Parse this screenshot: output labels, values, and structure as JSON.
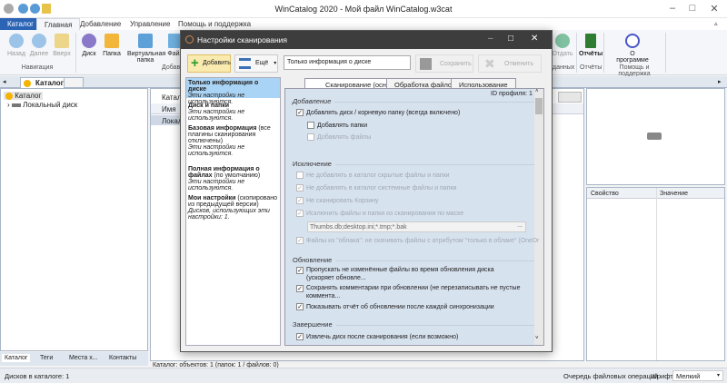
{
  "window": {
    "title": "WinCatalog 2020 - Мой файл WinCatalog.w3cat"
  },
  "ribbon_tabs": [
    "Каталог",
    "Главная",
    "Добавление",
    "Управление",
    "Помощь и поддержка"
  ],
  "ribbon": {
    "nav": [
      {
        "label": "Назад"
      },
      {
        "label": "Далее"
      },
      {
        "label": "Вверх"
      }
    ],
    "nav_group": "Навигация",
    "add": [
      {
        "label": "Диск"
      },
      {
        "label": "Папка"
      },
      {
        "label": "Виртуальная папка"
      },
      {
        "label": "Файл"
      }
    ],
    "add_group": "Добав",
    "give": "Отдать",
    "data_group": "данных",
    "reports": "Отчёты",
    "reports_group": "Отчёты",
    "about": "О программе",
    "help_group": "Помощь и поддержка"
  },
  "doc_tab": "Каталог",
  "tree": {
    "root": "Каталог",
    "items": [
      "Локальный диск"
    ]
  },
  "middle": {
    "path": "Катало",
    "col_name": "Имя",
    "row": "Локаль",
    "status": "Каталог: объектов: 1 (папок: 1 / файлов: 0)"
  },
  "bottom_tabs": [
    "Каталог",
    "Теги",
    "Места х...",
    "Контакты"
  ],
  "right": {
    "col_property": "Свойство",
    "col_value": "Значение"
  },
  "status": {
    "disks": "Дисков в каталоге: 1",
    "queue": "Очередь файловых операций",
    "font_label": "Шрифт:",
    "font_value": "Мелкий"
  },
  "dialog": {
    "title": "Настройки сканирования",
    "add": "Добавить",
    "more": "Ещё",
    "name_value": "Только информация о диске",
    "save": "Сохранить",
    "cancel": "Отменить",
    "profiles": [
      {
        "title": "Только информация о диске",
        "extra": "",
        "note": "Эти настройки не используются."
      },
      {
        "title": "Диск и папки",
        "extra": "",
        "note": "Эти настройки не используются."
      },
      {
        "title": "Базовая информация",
        "extra": " (все плагины сканирования отключены)",
        "note": "Эти настройки не используются."
      },
      {
        "title": "Полная информация о файлах",
        "extra": " (по умолчанию)",
        "note": "Эти настройки не используются."
      },
      {
        "title": "Мои настройки",
        "extra": " (скопировано из предыдущей версии)",
        "note": "Дисков, использующих эти настройки: 1."
      }
    ],
    "tabs": [
      "Сканирование (основное)",
      "Обработка файлов",
      "Использование"
    ],
    "profile_id": "ID профиля: 1",
    "sections": {
      "add": "Добавление",
      "exclude": "Исключение",
      "update": "Обновление",
      "finish": "Завершение"
    },
    "opts": {
      "add_disk": "Добавлять диск / корневую папку (всегда включено)",
      "add_folders": "Добавлять папки",
      "add_files": "Добавлять файлы",
      "ex_hidden": "Не добавлять в каталог скрытые файлы и папки",
      "ex_system": "Не добавлять в каталог системные файлы и папки",
      "ex_recycle": "Не сканировать Корзину",
      "ex_mask": "Исключить файлы и папки из сканирования по маске",
      "mask_value": "Thumbs.db;desktop.ini;*.tmp;*.bak",
      "ex_cloud": "Файлы из \"облака\": не скачивать файлы с атрибутом \"только в облаке\" (OneDr",
      "up_skip": "Пропускать не изменённые файлы во время обновления диска (ускоряет обновле...",
      "up_comments": "Сохранять комментарии при обновлении (не перезаписывать не пустые коммента...",
      "up_report": "Показывать отчёт об обновлении после каждой синхронизации",
      "fin_eject": "Извлечь диск после сканирования (если возможно)"
    }
  }
}
